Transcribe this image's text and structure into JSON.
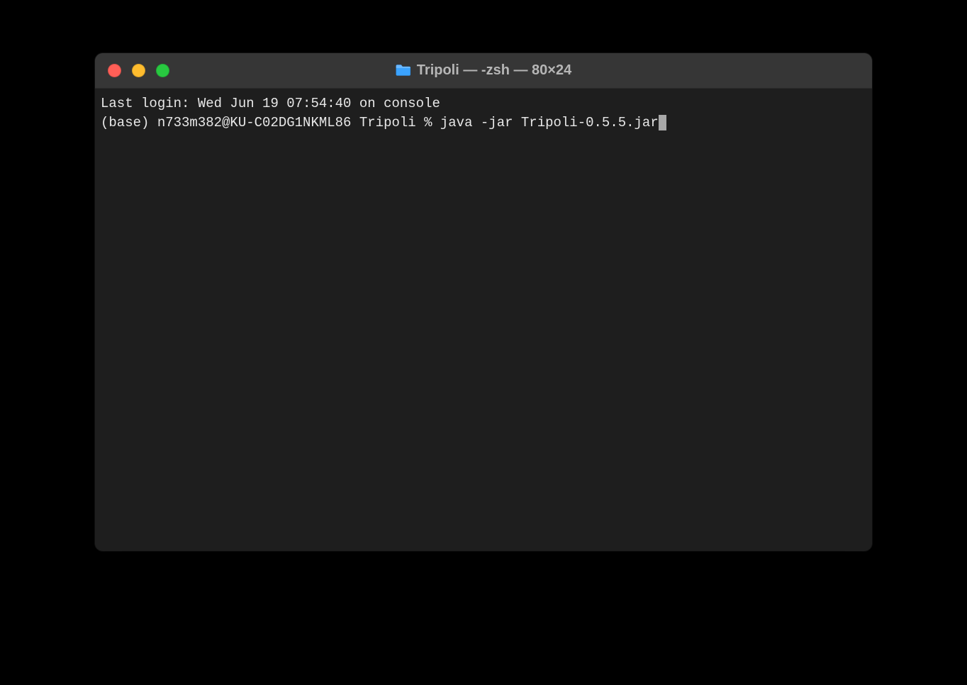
{
  "window": {
    "title": "Tripoli — -zsh — 80×24",
    "folderIconName": "folder-icon"
  },
  "terminal": {
    "lastLoginLine": "Last login: Wed Jun 19 07:54:40 on console",
    "promptLine": "(base) n733m382@KU-C02DG1NKML86 Tripoli % java -jar Tripoli-0.5.5.jar"
  },
  "colors": {
    "trafficRed": "#ff5f57",
    "trafficYellow": "#febc2e",
    "trafficGreen": "#28c840",
    "windowBg": "#1e1e1e",
    "titlebarBg": "#363636",
    "textColor": "#e8e8e8",
    "titleTextColor": "#b6b6b6"
  }
}
